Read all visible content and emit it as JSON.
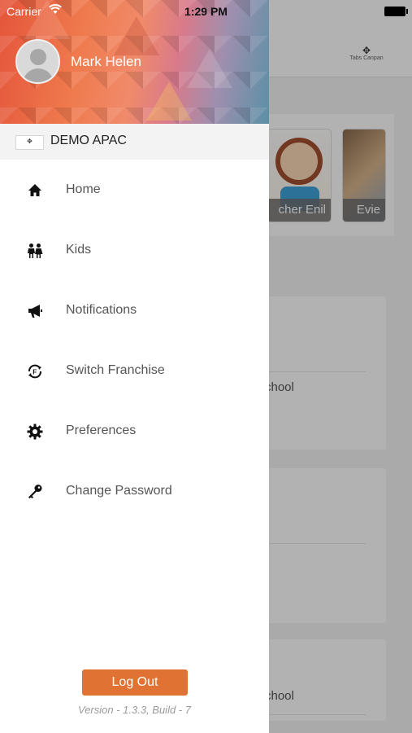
{
  "status_bar": {
    "carrier": "Carrier",
    "time": "1:29 PM",
    "wifi_icon": "wifi-icon",
    "battery_icon": "battery-icon"
  },
  "drawer": {
    "user_name": "Mark Helen",
    "franchise_name": "DEMO APAC",
    "menu": [
      {
        "label": "Home",
        "icon": "home-icon"
      },
      {
        "label": "Kids",
        "icon": "kids-icon"
      },
      {
        "label": "Notifications",
        "icon": "megaphone-icon"
      },
      {
        "label": "Switch Franchise",
        "icon": "switch-franchise-icon"
      },
      {
        "label": "Preferences",
        "icon": "gear-icon"
      },
      {
        "label": "Change Password",
        "icon": "key-icon"
      }
    ],
    "logout_label": "Log Out",
    "version_text": "Version - 1.3.3, Build - 7"
  },
  "background": {
    "logo_caption": "Tabs Canpan",
    "kids": [
      {
        "name": "cher Enil"
      },
      {
        "name": "Evie"
      }
    ],
    "card_texts": [
      "chool",
      "chool"
    ]
  },
  "colors": {
    "accent": "#e07334",
    "drawer_bg": "#ffffff",
    "franchise_bar": "#f3f3f3"
  }
}
